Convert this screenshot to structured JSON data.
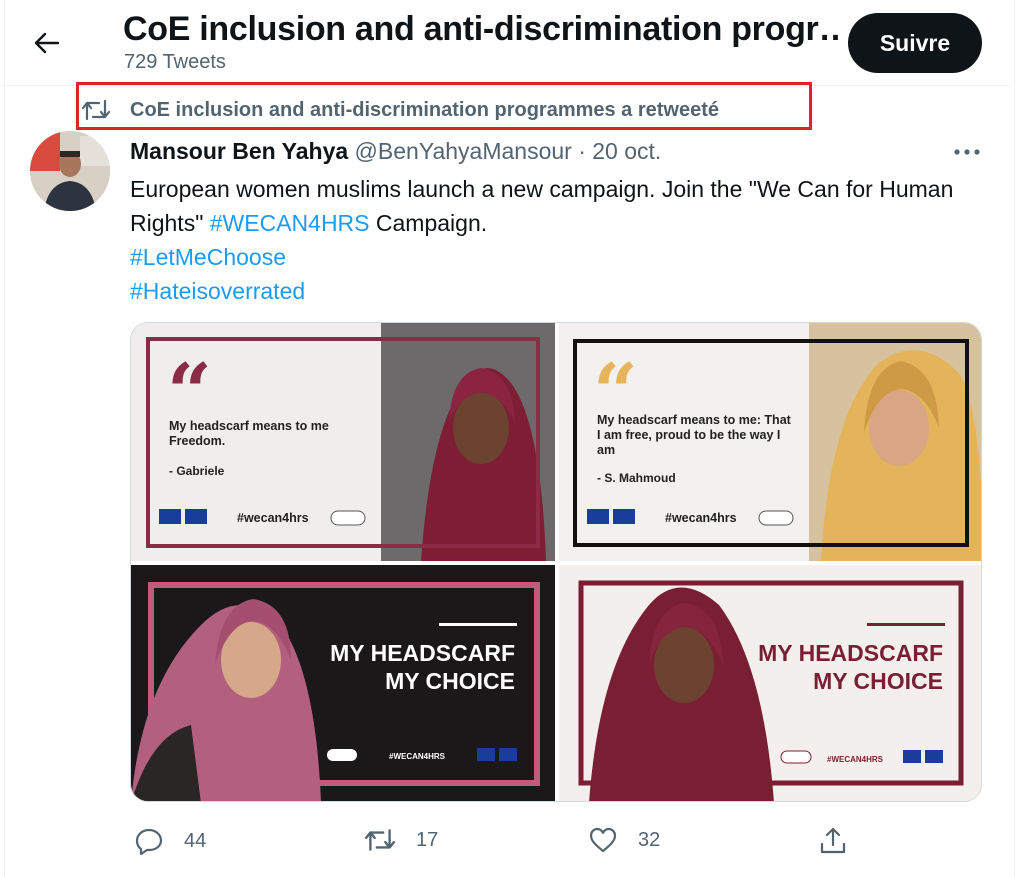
{
  "header": {
    "title": "CoE inclusion and anti-discrimination progr…",
    "subtitle": "729 Tweets",
    "follow_label": "Suivre"
  },
  "retweet_note": "CoE inclusion and anti-discrimination programmes a retweeté",
  "tweet": {
    "author_name": "Mansour Ben Yahya",
    "author_handle": "@BenYahyaMansour",
    "separator": "·",
    "date": "20 oct.",
    "text_part1": "European women muslims launch a new campaign. Join the \"We Can for Human Rights\" ",
    "hashtag1": "#WECAN4HRS",
    "text_part2": " Campaign.",
    "hashtag2": "#LetMeChoose",
    "hashtag3": "#Hateisoverrated",
    "media": {
      "img1": {
        "quote": "My headscarf means to me Freedom.",
        "author": "- Gabriele",
        "hashtag": "#wecan4hrs"
      },
      "img2": {
        "quote": "My headscarf means to me: That I am free, proud to be the way I am",
        "author": "- S. Mahmoud",
        "hashtag": "#wecan4hrs"
      },
      "img3": {
        "line1": "MY HEADSCARF",
        "line2": "MY CHOICE",
        "hashtag": "#WECAN4HRS"
      },
      "img4": {
        "line1": "MY HEADSCARF",
        "line2": "MY CHOICE",
        "hashtag": "#WECAN4HRS"
      }
    },
    "actions": {
      "replies": "44",
      "retweets": "17",
      "likes": "32"
    }
  },
  "colors": {
    "accent": "#1d9bf0",
    "highlight_box": "#e0202b",
    "maroon": "#7a1f33",
    "gold": "#e8b45a",
    "pink_frame": "#c25a7c"
  }
}
